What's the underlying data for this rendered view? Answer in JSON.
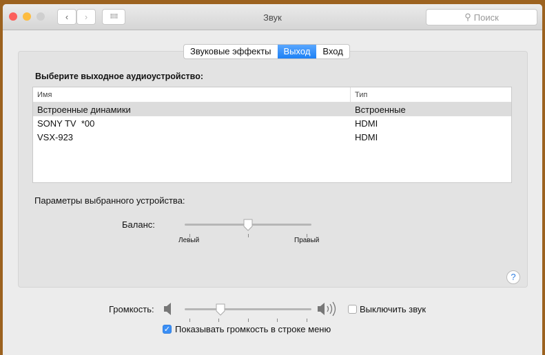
{
  "window": {
    "title": "Звук",
    "search_placeholder": "Поиск"
  },
  "tabs": [
    {
      "label": "Звуковые эффекты",
      "active": false
    },
    {
      "label": "Выход",
      "active": true
    },
    {
      "label": "Вход",
      "active": false
    }
  ],
  "output": {
    "heading": "Выберите выходное аудиоустройство:",
    "columns": [
      "Имя",
      "Тип"
    ],
    "rows": [
      {
        "name": "Встроенные динамики",
        "type": "Встроенные",
        "selected": true
      },
      {
        "name": "SONY TV  *00",
        "type": "HDMI"
      },
      {
        "name": "VSX-923",
        "type": "HDMI"
      }
    ]
  },
  "device_settings": {
    "heading": "Параметры выбранного устройства:",
    "balance_label": "Баланс:",
    "left_label": "Левый",
    "right_label": "Правый",
    "balance_value": 0.5
  },
  "volume": {
    "label": "Громкость:",
    "value": 0.28,
    "mute_label": "Выключить звук",
    "mute_checked": false,
    "show_in_menu_label": "Показывать громкость в строке меню",
    "show_in_menu_checked": true
  },
  "help_label": "?"
}
